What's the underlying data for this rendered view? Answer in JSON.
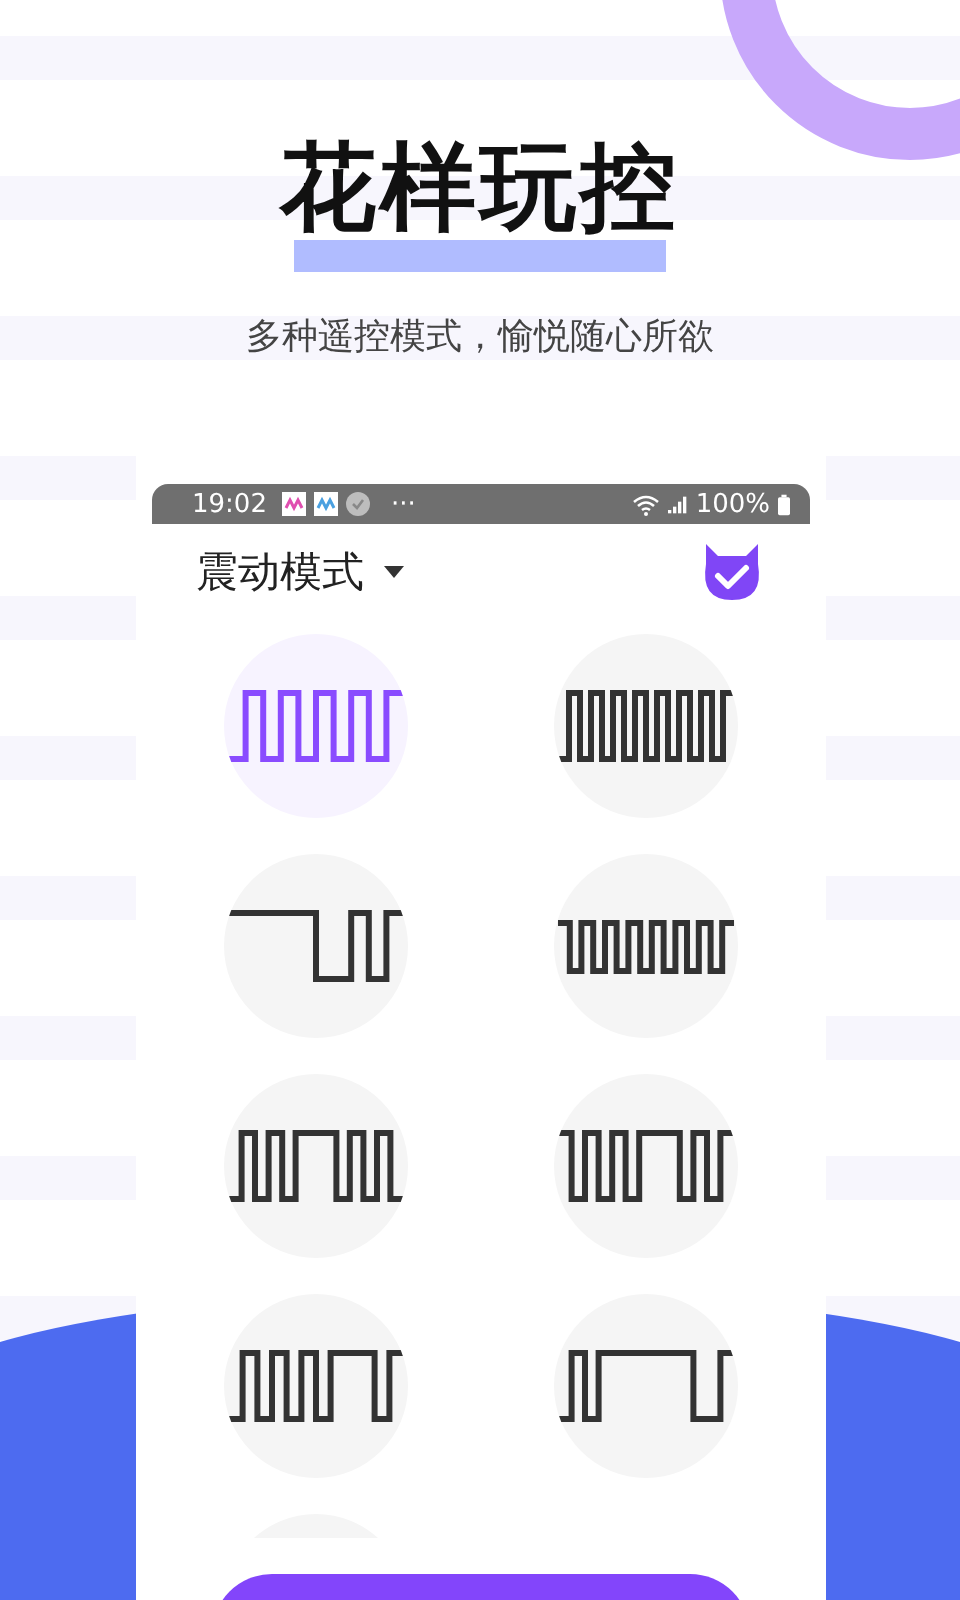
{
  "headline": "花样玩控",
  "subtitle": "多种遥控模式，愉悦随心所欲",
  "status_bar": {
    "time": "19:02",
    "more": "···",
    "battery": "100%"
  },
  "header": {
    "mode_label": "震动模式"
  },
  "modes": [
    {
      "selected": true
    },
    {
      "selected": false
    },
    {
      "selected": false
    },
    {
      "selected": false
    },
    {
      "selected": false
    },
    {
      "selected": false
    },
    {
      "selected": false
    },
    {
      "selected": false
    }
  ]
}
